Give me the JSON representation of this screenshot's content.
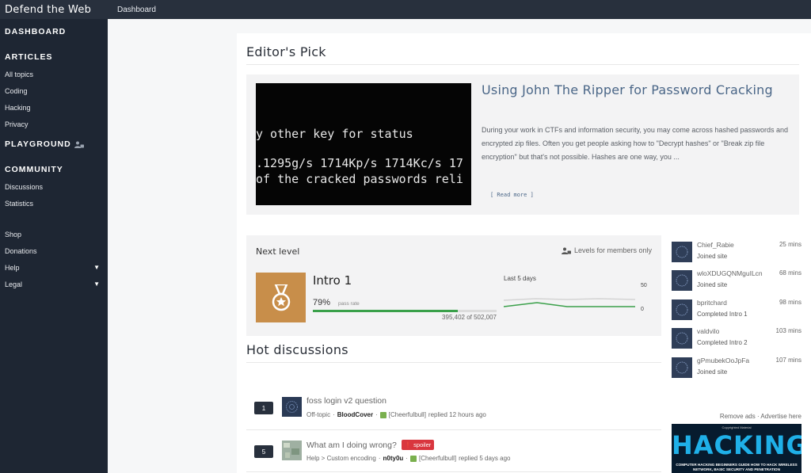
{
  "topbar": {
    "brand": "Defend the Web",
    "breadcrumb": "Dashboard"
  },
  "sidebar": {
    "dashboard": "DASHBOARD",
    "articles_head": "ARTICLES",
    "articles": [
      "All topics",
      "Coding",
      "Hacking",
      "Privacy"
    ],
    "playground_head": "PLAYGROUND",
    "community_head": "COMMUNITY",
    "community": [
      "Discussions",
      "Statistics"
    ],
    "misc": [
      "Shop",
      "Donations",
      "Help",
      "Legal"
    ]
  },
  "editors_pick": {
    "heading": "Editor's Pick",
    "image_lines": [
      "y other key for status",
      ".1295g/s 1714Kp/s 1714Kc/s 17",
      "of the cracked passwords reli"
    ],
    "title": "Using John The Ripper for Password Cracking",
    "excerpt": "During your work in CTFs and information security, you may come across hashed passwords and encrypted zip files. Often you get people asking how to \"Decrypt hashes\" or \"Break zip file encryption\" but that's not possible. Hashes are one way, you ...",
    "read_more": "[ Read more ]"
  },
  "next_level": {
    "heading": "Next level",
    "members_only": "Levels for members only",
    "level_name": "Intro 1",
    "pass_pct": "79%",
    "pass_fraction": 0.79,
    "pass_label": "pass rate",
    "pass_count": "395,402 of 502,007",
    "chart_label": "Last 5 days",
    "axis_max": "50",
    "axis_min": "0"
  },
  "hot_discussions": {
    "heading": "Hot discussions",
    "items": [
      {
        "count": "1",
        "title": "foss login v2 question",
        "category": "Off-topic",
        "author": "BloodCover",
        "replier": "[Cheerfulbull]",
        "when": "replied 12 hours ago",
        "badge": ""
      },
      {
        "count": "5",
        "title": "What am I doing wrong?",
        "category": "Help > Custom encoding",
        "author": "n0ty0u",
        "replier": "[Cheerfulbull]",
        "when": "replied 5 days ago",
        "badge": "spoiler"
      }
    ]
  },
  "activity": [
    {
      "name": "Chief_Rabie",
      "action": "Joined site",
      "time": "25 mins"
    },
    {
      "name": "wloXDUGQNMguILcn",
      "action": "Joined site",
      "time": "68 mins"
    },
    {
      "name": "bpritchard",
      "action": "Completed Intro 1",
      "time": "98 mins"
    },
    {
      "name": "valdvilo",
      "action": "Completed Intro 2",
      "time": "103 mins"
    },
    {
      "name": "gPmubekOoJpFa",
      "action": "Joined site",
      "time": "107 mins"
    }
  ],
  "ads": {
    "links": "Remove ads · Advertise here",
    "small": "Copyrighted Material",
    "big": "HACKING",
    "sub": "COMPUTER HACKING BEGINNERS GUIDE HOW TO HACK WIRELESS NETWORK, BASIC SECURITY AND PENETRATION"
  },
  "colors": {
    "sidebar": "#1e2633",
    "topbar": "#28303d",
    "accent_green": "#3aa04a",
    "link_blue": "#4a6687",
    "spoiler_red": "#d9363e",
    "medal_bronze": "#c88e4a"
  }
}
